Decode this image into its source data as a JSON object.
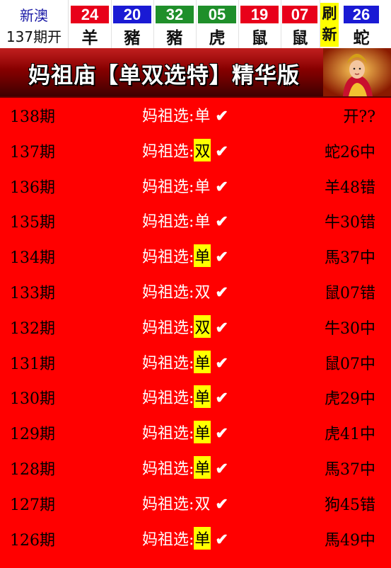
{
  "header": {
    "region": "新澳",
    "period": "137期开",
    "balls": [
      {
        "num": "24",
        "zodiac": "羊",
        "color": "#e8001a"
      },
      {
        "num": "20",
        "zodiac": "豬",
        "color": "#1a1ad4"
      },
      {
        "num": "32",
        "zodiac": "豬",
        "color": "#1f8f2a"
      },
      {
        "num": "05",
        "zodiac": "虎",
        "color": "#1f8f2a"
      },
      {
        "num": "19",
        "zodiac": "鼠",
        "color": "#e8001a"
      },
      {
        "num": "07",
        "zodiac": "鼠",
        "color": "#e8001a"
      }
    ],
    "refresh": [
      "刷",
      "新"
    ],
    "special": {
      "num": "26",
      "zodiac": "蛇",
      "color": "#1a1ad4"
    }
  },
  "banner": {
    "title": "妈祖庙【单双选特】精华版"
  },
  "rows": [
    {
      "period": "138期",
      "prefix": "妈祖选:",
      "value": "单",
      "highlight": false,
      "check": "✔",
      "result": "开??"
    },
    {
      "period": "137期",
      "prefix": "妈祖选:",
      "value": "双",
      "highlight": true,
      "check": "✔",
      "result": "蛇26中"
    },
    {
      "period": "136期",
      "prefix": "妈祖选:",
      "value": "单",
      "highlight": false,
      "check": "✔",
      "result": "羊48错"
    },
    {
      "period": "135期",
      "prefix": "妈祖选:",
      "value": "单",
      "highlight": false,
      "check": "✔",
      "result": "牛30错"
    },
    {
      "period": "134期",
      "prefix": "妈祖选:",
      "value": "单",
      "highlight": true,
      "check": "✔",
      "result": "馬37中"
    },
    {
      "period": "133期",
      "prefix": "妈祖选:",
      "value": "双",
      "highlight": false,
      "check": "✔",
      "result": "鼠07错"
    },
    {
      "period": "132期",
      "prefix": "妈祖选:",
      "value": "双",
      "highlight": true,
      "check": "✔",
      "result": "牛30中"
    },
    {
      "period": "131期",
      "prefix": "妈祖选:",
      "value": "单",
      "highlight": true,
      "check": "✔",
      "result": "鼠07中"
    },
    {
      "period": "130期",
      "prefix": "妈祖选:",
      "value": "单",
      "highlight": true,
      "check": "✔",
      "result": "虎29中"
    },
    {
      "period": "129期",
      "prefix": "妈祖选:",
      "value": "单",
      "highlight": true,
      "check": "✔",
      "result": "虎41中"
    },
    {
      "period": "128期",
      "prefix": "妈祖选:",
      "value": "单",
      "highlight": true,
      "check": "✔",
      "result": "馬37中"
    },
    {
      "period": "127期",
      "prefix": "妈祖选:",
      "value": "双",
      "highlight": false,
      "check": "✔",
      "result": "狗45错"
    },
    {
      "period": "126期",
      "prefix": "妈祖选:",
      "value": "单",
      "highlight": true,
      "check": "✔",
      "result": "馬49中"
    }
  ]
}
